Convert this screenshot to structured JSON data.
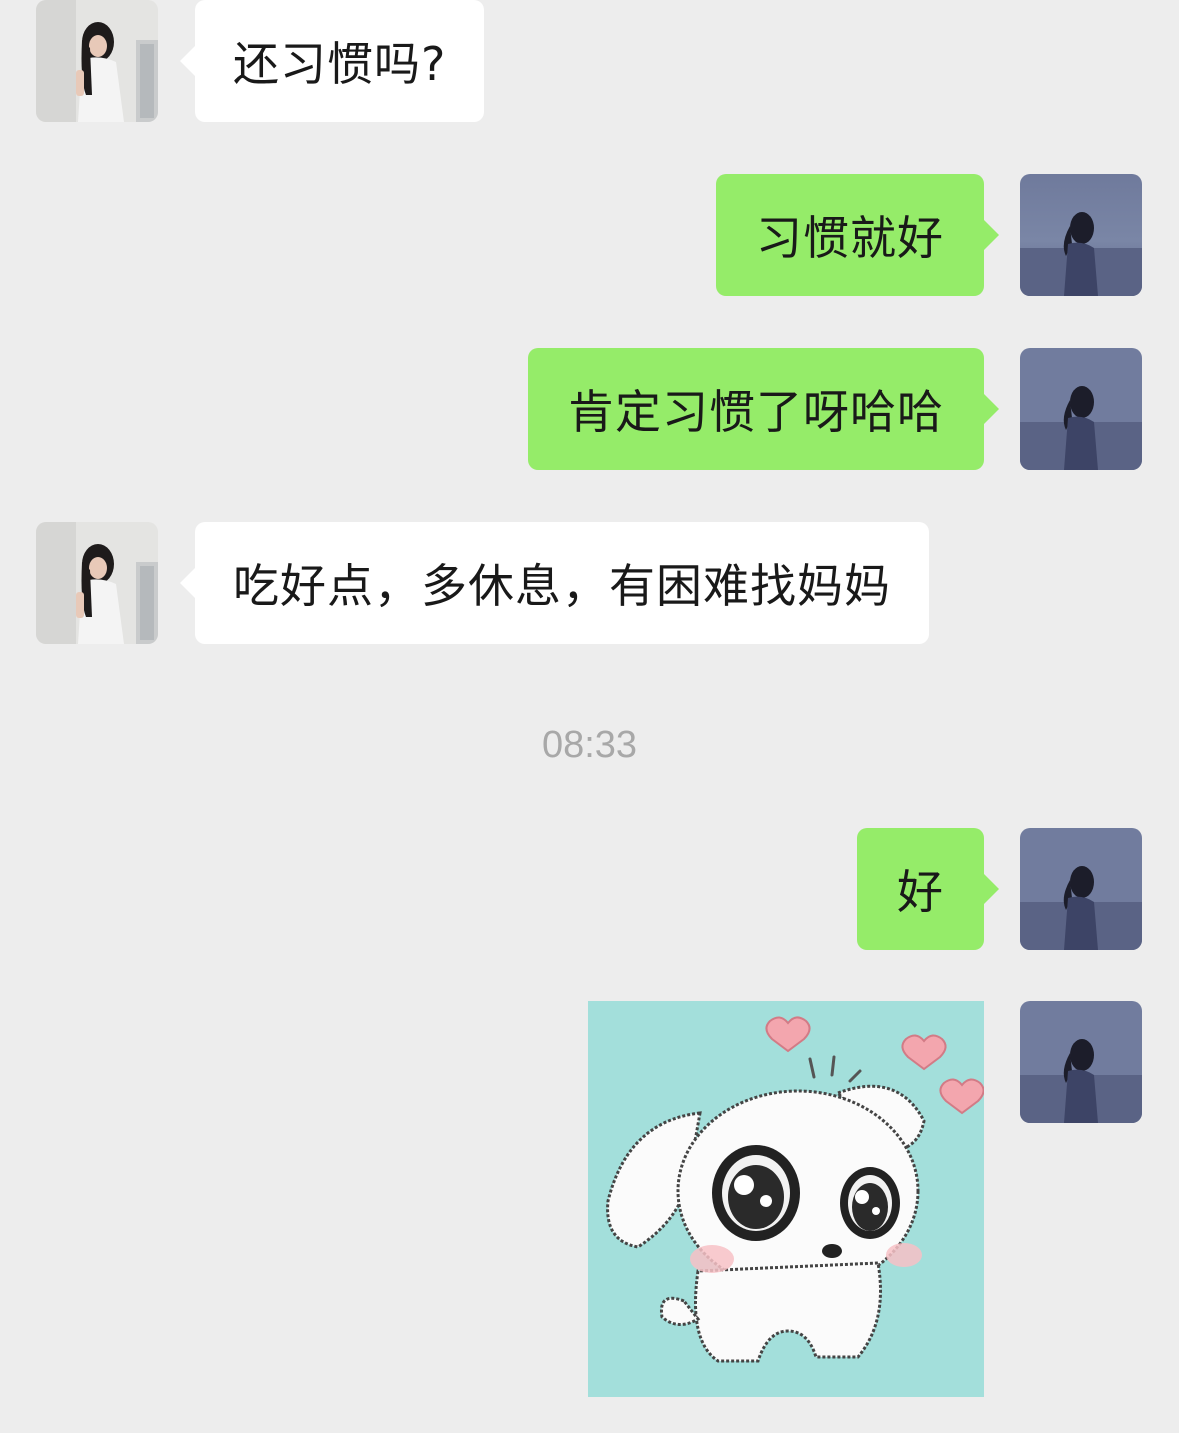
{
  "messages": [
    {
      "side": "in",
      "text": "还习惯吗?"
    },
    {
      "side": "out",
      "text": "习惯就好"
    },
    {
      "side": "out",
      "text": "肯定习惯了呀哈哈"
    },
    {
      "side": "in",
      "text": "吃好点，多休息，有困难找妈妈"
    },
    {
      "side": "out",
      "text": "好"
    },
    {
      "side": "out",
      "type": "sticker",
      "sticker": "cute-white-puppy-with-hearts"
    }
  ],
  "timestamp": "08:33",
  "colors": {
    "background": "#ededed",
    "incoming_bubble": "#ffffff",
    "outgoing_bubble": "#95ec69",
    "timestamp_text": "#a8a8a8",
    "sticker_background": "#a3dfdb"
  },
  "icons": {
    "contact_avatar": "contact-avatar-girl-by-wall",
    "self_avatar": "self-avatar-girl-by-sea"
  }
}
